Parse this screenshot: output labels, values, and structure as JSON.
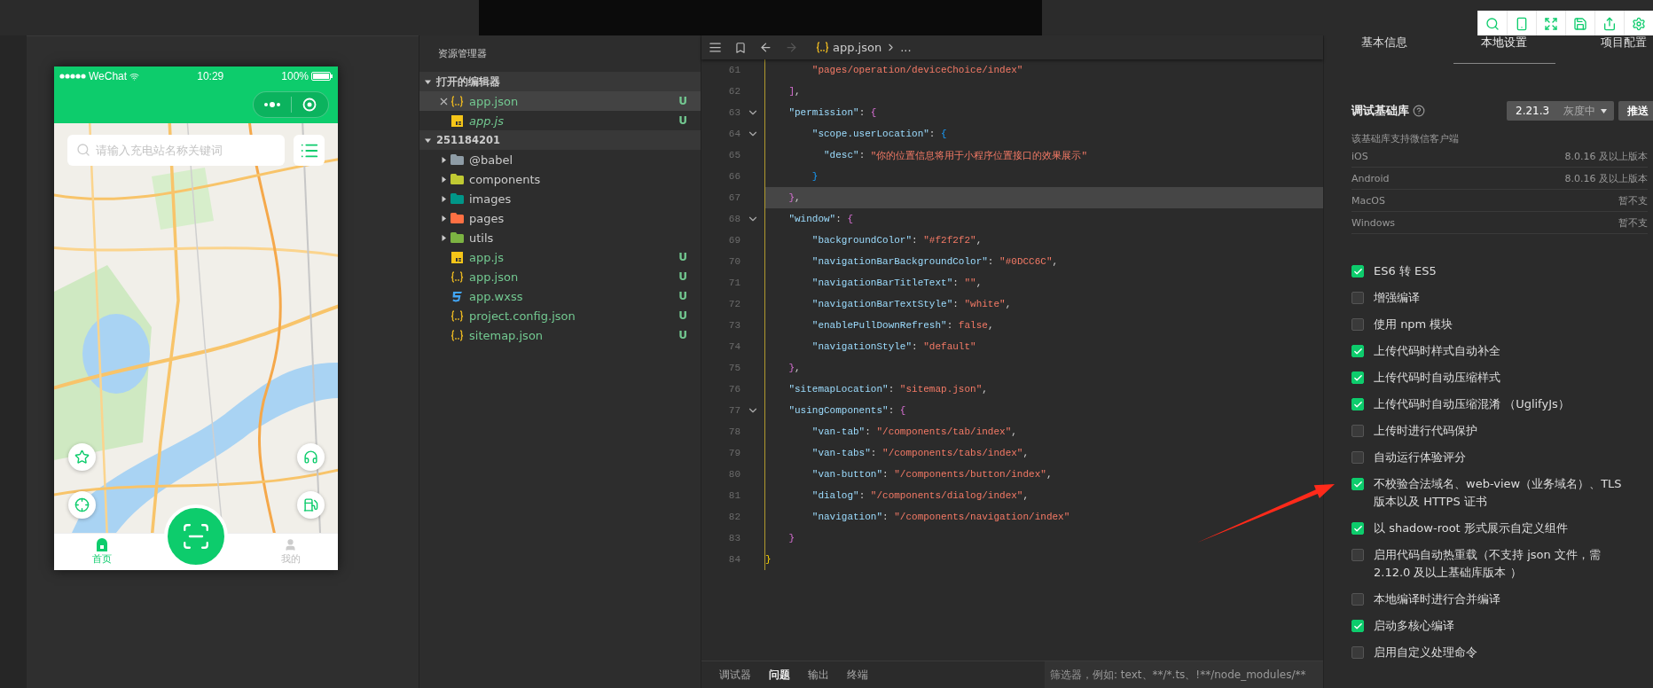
{
  "simulator": {
    "status_bar": {
      "carrier": "WeChat",
      "time": "10:29",
      "battery": "100%"
    },
    "search": {
      "placeholder": "请输入充电站名称关键词"
    },
    "tab_bar": [
      {
        "label": "首页",
        "selected": true
      },
      {
        "label": "我的",
        "selected": false
      }
    ]
  },
  "explorer": {
    "title": "资源管理器",
    "sections": [
      {
        "label": "打开的编辑器",
        "expanded": true,
        "items": [
          {
            "name": "app.json",
            "kind": "json",
            "status": "U",
            "selected": true,
            "preview": false
          },
          {
            "name": "app.js",
            "kind": "js",
            "status": "U",
            "selected": false,
            "preview": true
          }
        ]
      },
      {
        "label": "251184201",
        "expanded": true,
        "items": [
          {
            "name": "@babel",
            "kind": "folder",
            "color": "#8e9ca6",
            "expanded": false,
            "selected": false
          },
          {
            "name": "components",
            "kind": "folder",
            "color": "#c0ca33",
            "expanded": false,
            "selected": false
          },
          {
            "name": "images",
            "kind": "folder",
            "color": "#009688",
            "expanded": false,
            "selected": false
          },
          {
            "name": "pages",
            "kind": "folder",
            "color": "#ff7043",
            "expanded": false,
            "selected": false
          },
          {
            "name": "utils",
            "kind": "folder",
            "color": "#7cb342",
            "expanded": false,
            "selected": false
          },
          {
            "name": "app.js",
            "kind": "js",
            "status": "U",
            "selected": false
          },
          {
            "name": "app.json",
            "kind": "json",
            "status": "U",
            "selected": false
          },
          {
            "name": "app.wxss",
            "kind": "wxss",
            "status": "U",
            "selected": false
          },
          {
            "name": "project.config.json",
            "kind": "json",
            "status": "U",
            "selected": false
          },
          {
            "name": "sitemap.json",
            "kind": "json",
            "status": "U",
            "selected": false
          }
        ]
      }
    ]
  },
  "editor": {
    "breadcrumb": {
      "file": "app.json",
      "rest": "..."
    },
    "lines": [
      {
        "number": "61",
        "text": "        \"pages/operation/deviceChoice/index\"",
        "foldable": false,
        "current": false
      },
      {
        "number": "62",
        "text": "    ],",
        "foldable": false,
        "current": false
      },
      {
        "number": "63",
        "text": "    \"permission\": {",
        "foldable": true,
        "current": false
      },
      {
        "number": "64",
        "text": "        \"scope.userLocation\": {",
        "foldable": true,
        "current": false
      },
      {
        "number": "65",
        "text": "          \"desc\": \"你的位置信息将用于小程序位置接口的效果展示\"",
        "foldable": false,
        "current": false
      },
      {
        "number": "66",
        "text": "        }",
        "foldable": false,
        "current": false
      },
      {
        "number": "67",
        "text": "    },",
        "foldable": false,
        "current": true
      },
      {
        "number": "68",
        "text": "    \"window\": {",
        "foldable": true,
        "current": false
      },
      {
        "number": "69",
        "text": "        \"backgroundColor\": \"#f2f2f2\",",
        "foldable": false,
        "current": false
      },
      {
        "number": "70",
        "text": "        \"navigationBarBackgroundColor\": \"#0DCC6C\",",
        "foldable": false,
        "current": false
      },
      {
        "number": "71",
        "text": "        \"navigationBarTitleText\": \"\",",
        "foldable": false,
        "current": false
      },
      {
        "number": "72",
        "text": "        \"navigationBarTextStyle\": \"white\",",
        "foldable": false,
        "current": false
      },
      {
        "number": "73",
        "text": "        \"enablePullDownRefresh\": false,",
        "foldable": false,
        "current": false
      },
      {
        "number": "74",
        "text": "        \"navigationStyle\": \"default\"",
        "foldable": false,
        "current": false
      },
      {
        "number": "75",
        "text": "    },",
        "foldable": false,
        "current": false
      },
      {
        "number": "76",
        "text": "    \"sitemapLocation\": \"sitemap.json\",",
        "foldable": false,
        "current": false
      },
      {
        "number": "77",
        "text": "    \"usingComponents\": {",
        "foldable": true,
        "current": false
      },
      {
        "number": "78",
        "text": "        \"van-tab\": \"/components/tab/index\",",
        "foldable": false,
        "current": false
      },
      {
        "number": "79",
        "text": "        \"van-tabs\": \"/components/tabs/index\",",
        "foldable": false,
        "current": false
      },
      {
        "number": "80",
        "text": "        \"van-button\": \"/components/button/index\",",
        "foldable": false,
        "current": false
      },
      {
        "number": "81",
        "text": "        \"dialog\": \"/components/dialog/index\",",
        "foldable": false,
        "current": false
      },
      {
        "number": "82",
        "text": "        \"navigation\": \"/components/navigation/index\"",
        "foldable": false,
        "current": false
      },
      {
        "number": "83",
        "text": "    }",
        "foldable": false,
        "current": false
      },
      {
        "number": "84",
        "text": "}",
        "foldable": false,
        "current": false
      }
    ]
  },
  "bottom_panel": {
    "tabs": [
      {
        "label": "调试器",
        "selected": false
      },
      {
        "label": "问题",
        "selected": true
      },
      {
        "label": "输出",
        "selected": false
      },
      {
        "label": "终端",
        "selected": false
      }
    ],
    "filter": {
      "placeholder": "筛选器，例如: text、**/*.ts、!**/node_modules/**"
    }
  },
  "settings": {
    "tabs": [
      {
        "label": "基本信息",
        "selected": false
      },
      {
        "label": "本地设置",
        "selected": true
      },
      {
        "label": "项目配置",
        "selected": false
      }
    ],
    "base_library": {
      "label": "调试基础库",
      "version": "2.21.3",
      "channel": "灰度中",
      "push_button": "推送"
    },
    "support_note": "该基础库支持微信客户端",
    "clients": [
      {
        "platform": "iOS",
        "requirement": "8.0.16 及以上版本"
      },
      {
        "platform": "Android",
        "requirement": "8.0.16 及以上版本"
      },
      {
        "platform": "MacOS",
        "requirement": "暂不支"
      },
      {
        "platform": "Windows",
        "requirement": "暂不支"
      }
    ],
    "options": [
      {
        "label": "ES6 转 ES5",
        "checked": true
      },
      {
        "label": "增强编译",
        "checked": false
      },
      {
        "label": "使用 npm 模块",
        "checked": false
      },
      {
        "label": "上传代码时样式自动补全",
        "checked": true
      },
      {
        "label": "上传代码时自动压缩样式",
        "checked": true
      },
      {
        "label": "上传代码时自动压缩混淆 （UglifyJs）",
        "checked": true
      },
      {
        "label": "上传时进行代码保护",
        "checked": false
      },
      {
        "label": "自动运行体验评分",
        "checked": false
      },
      {
        "label": "不校验合法域名、web-view（业务域名）、TLS 版本以及 HTTPS 证书",
        "checked": true
      },
      {
        "label": "以 shadow-root 形式展示自定义组件",
        "checked": true
      },
      {
        "label": "启用代码自动热重载（不支持 json 文件，需 2.12.0 及以上基础库版本 ）",
        "checked": false
      },
      {
        "label": "本地编译时进行合并编译",
        "checked": false
      },
      {
        "label": "启动多核心编译",
        "checked": true
      },
      {
        "label": "启用自定义处理命令",
        "checked": false
      }
    ]
  }
}
